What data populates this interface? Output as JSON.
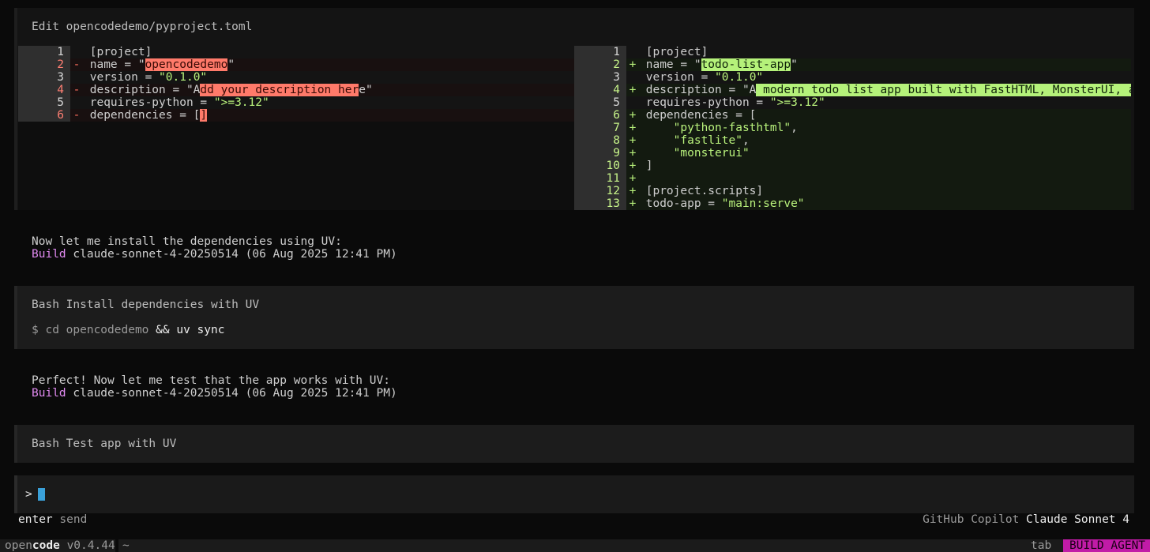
{
  "edit": {
    "title": "Edit opencodedemo/pyproject.toml",
    "left": {
      "rows": [
        {
          "n": "1",
          "m": "",
          "t": "[project]",
          "type": "ctx"
        },
        {
          "n": "2",
          "m": "-",
          "pre": "name = \"",
          "hl": "opencodedemo",
          "post": "\"",
          "type": "del"
        },
        {
          "n": "3",
          "m": "",
          "pre": "version = ",
          "str": "\"0.1.0\"",
          "type": "ctx"
        },
        {
          "n": "4",
          "m": "-",
          "pre": "description = \"A",
          "hl": "dd your description her",
          "post": "e\"",
          "type": "del"
        },
        {
          "n": "5",
          "m": "",
          "pre": "requires-python = ",
          "str": "\">=3.12\"",
          "type": "ctx"
        },
        {
          "n": "6",
          "m": "-",
          "pre": "dependencies = [",
          "hl": "]",
          "post": "",
          "type": "del"
        }
      ]
    },
    "right": {
      "rows": [
        {
          "n": "1",
          "m": "",
          "t": "[project]",
          "type": "ctx"
        },
        {
          "n": "2",
          "m": "+",
          "pre": "name = \"",
          "hl": "todo-list-app",
          "post": "\"",
          "type": "add"
        },
        {
          "n": "3",
          "m": "",
          "pre": "version = ",
          "str": "\"0.1.0\"",
          "type": "ctx"
        },
        {
          "n": "4",
          "m": "+",
          "pre": "description = \"A",
          "hl": " modern todo list app built with FastHTML, MonsterUI, an...",
          "post": "",
          "type": "add"
        },
        {
          "n": "5",
          "m": "",
          "pre": "requires-python = ",
          "str": "\">=3.12\"",
          "type": "ctx"
        },
        {
          "n": "6",
          "m": "+",
          "t": "dependencies = [",
          "type": "add"
        },
        {
          "n": "7",
          "m": "+",
          "pre": "    ",
          "str": "\"python-fasthtml\"",
          "post": ",",
          "type": "add"
        },
        {
          "n": "8",
          "m": "+",
          "pre": "    ",
          "str": "\"fastlite\"",
          "post": ",",
          "type": "add"
        },
        {
          "n": "9",
          "m": "+",
          "pre": "    ",
          "str": "\"monsterui\"",
          "post": "",
          "type": "add"
        },
        {
          "n": "10",
          "m": "+",
          "t": "]",
          "type": "add"
        },
        {
          "n": "11",
          "m": "+",
          "t": "",
          "type": "add"
        },
        {
          "n": "12",
          "m": "+",
          "t": "[project.scripts]",
          "type": "add"
        },
        {
          "n": "13",
          "m": "+",
          "pre": "todo-app = ",
          "str": "\"main:serve\"",
          "type": "add"
        }
      ]
    }
  },
  "messages": [
    {
      "text": "Now let me install the dependencies using UV:",
      "agent": "Build",
      "meta": "claude-sonnet-4-20250514 (06 Aug 2025 12:41 PM)"
    },
    {
      "text": "Perfect! Now let me test that the app works with UV:",
      "agent": "Build",
      "meta": "claude-sonnet-4-20250514 (06 Aug 2025 12:41 PM)"
    }
  ],
  "bash1": {
    "title": "Bash Install dependencies with UV",
    "cmd_prefix": "$ cd opencodedemo ",
    "cmd_amp": "&&",
    "cmd_rest": " uv sync"
  },
  "bash2": {
    "title": "Bash Test app with UV"
  },
  "input": {
    "prompt": ">"
  },
  "hints": {
    "enter_key": "enter",
    "enter_action": " send",
    "provider": "GitHub Copilot ",
    "model": "Claude Sonnet 4"
  },
  "status": {
    "brand_a": "open",
    "brand_b": "code",
    "version": " v0.4.44",
    "path": "~",
    "tab": "tab",
    "agent": "BUILD AGENT",
    "agent_color": "#c11ba7"
  }
}
